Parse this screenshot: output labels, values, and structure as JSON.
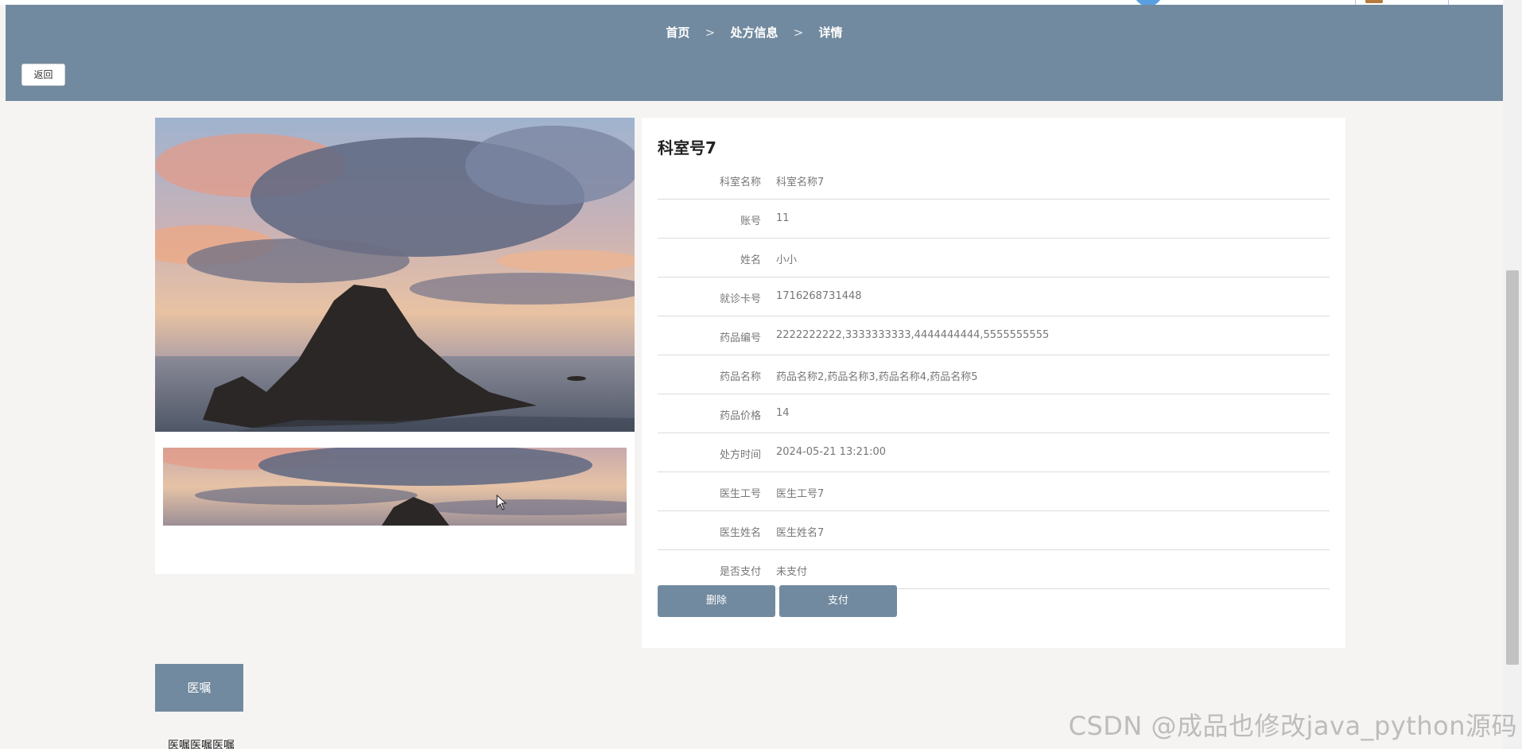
{
  "breadcrumb": {
    "home": "首页",
    "section": "处方信息",
    "current": "详情",
    "separator": ">"
  },
  "back_label": "返回",
  "detail": {
    "title": "科室号7",
    "rows": [
      {
        "label": "科室名称",
        "value": "科室名称7"
      },
      {
        "label": "账号",
        "value": "11"
      },
      {
        "label": "姓名",
        "value": "小小"
      },
      {
        "label": "就诊卡号",
        "value": "1716268731448"
      },
      {
        "label": "药品编号",
        "value": "2222222222,3333333333,4444444444,5555555555"
      },
      {
        "label": "药品名称",
        "value": "药品名称2,药品名称3,药品名称4,药品名称5"
      },
      {
        "label": "药品价格",
        "value": "14"
      },
      {
        "label": "处方时间",
        "value": "2024-05-21 13:21:00"
      },
      {
        "label": "医生工号",
        "value": "医生工号7"
      },
      {
        "label": "医生姓名",
        "value": "医生姓名7"
      },
      {
        "label": "是否支付",
        "value": "未支付"
      }
    ],
    "delete_label": "删除",
    "pay_label": "支付"
  },
  "order": {
    "tab_label": "医嘱",
    "content": "医嘱医嘱医嘱"
  },
  "watermark": "CSDN @成品也修改java_python源码",
  "colors": {
    "accent": "#728a9f",
    "background": "#f5f4f2"
  }
}
